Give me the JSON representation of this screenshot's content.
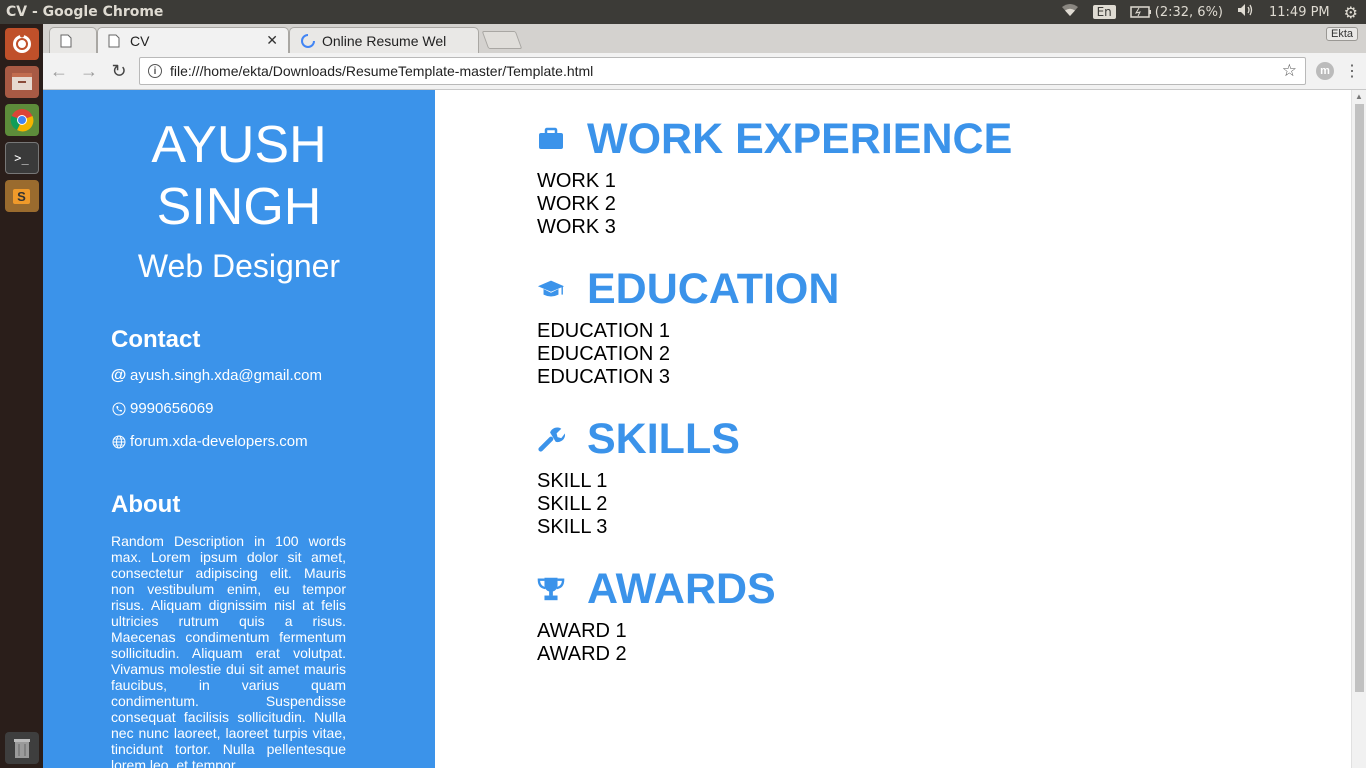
{
  "os": {
    "window_title": "CV - Google Chrome",
    "keyboard_layout": "En",
    "battery": "(2:32, 6%)",
    "clock": "11:49 PM"
  },
  "browser": {
    "tabs": [
      {
        "label": "",
        "icon": "page-icon"
      },
      {
        "label": "CV",
        "icon": "page-icon",
        "close": "✕"
      },
      {
        "label": "Online Resume Wel",
        "icon": "loading-spinner-icon"
      }
    ],
    "profile": "Ekta",
    "url": "file:///home/ekta/Downloads/ResumeTemplate-master/Template.html"
  },
  "resume": {
    "name_line1": "AYUSH",
    "name_line2": "SINGH",
    "role": "Web Designer",
    "contact_heading": "Contact",
    "email": "ayush.singh.xda@gmail.com",
    "phone": "9990656069",
    "website": "forum.xda-developers.com",
    "about_heading": "About",
    "about_text": "Random Description in 100 words max. Lorem ipsum dolor sit amet, consectetur adipiscing elit. Mauris non vestibulum enim, eu tempor risus. Aliquam dignissim nisl at felis ultricies rutrum quis a risus. Maecenas condimentum fermentum sollicitudin. Aliquam erat volutpat. Vivamus molestie dui sit amet mauris faucibus, in varius quam condimentum. Suspendisse consequat facilisis sollicitudin. Nulla nec nunc laoreet, laoreet turpis vitae, tincidunt tortor. Nulla pellentesque lorem leo, et tempor",
    "sections": [
      {
        "title": "WORK EXPERIENCE",
        "icon": "briefcase-icon",
        "items": [
          "WORK 1",
          "WORK 2",
          "WORK 3"
        ]
      },
      {
        "title": "EDUCATION",
        "icon": "graduation-cap-icon",
        "items": [
          "EDUCATION 1",
          "EDUCATION 2",
          "EDUCATION 3"
        ]
      },
      {
        "title": "SKILLS",
        "icon": "wrench-icon",
        "items": [
          "SKILL 1",
          "SKILL 2",
          "SKILL 3"
        ]
      },
      {
        "title": "AWARDS",
        "icon": "trophy-icon",
        "items": [
          "AWARD 1",
          "AWARD 2"
        ]
      }
    ]
  },
  "colors": {
    "accent": "#3b93ea",
    "panel": "#3c3b37",
    "launcher": "#2a1e1a"
  }
}
